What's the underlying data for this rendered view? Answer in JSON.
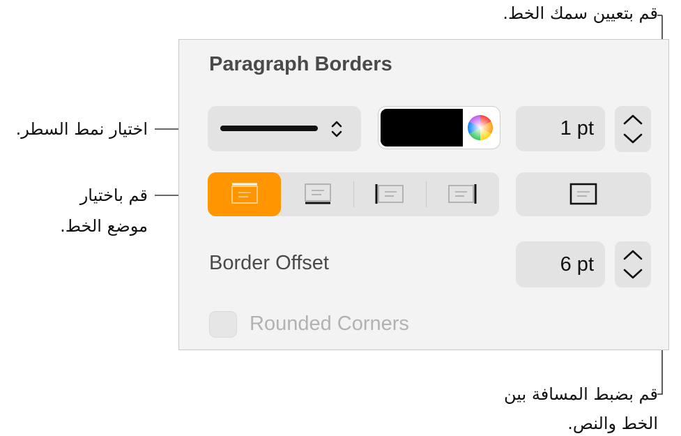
{
  "callouts": {
    "thickness": "قم بتعيين سمك الخط.",
    "line_style": "اختيار نمط السطر.",
    "position_line1": "قم باختيار",
    "position_line2": "موضع الخط.",
    "offset_line1": "قم بضبط المسافة بين",
    "offset_line2": "الخط والنص."
  },
  "panel": {
    "title": "Paragraph Borders",
    "line_style": "solid",
    "border_color": "#000000",
    "thickness_value": "1 pt",
    "position_buttons": [
      "top",
      "bottom",
      "left",
      "right"
    ],
    "selected_position": "top",
    "box_button": "box",
    "border_offset_label": "Border Offset",
    "border_offset_value": "6 pt",
    "rounded_corners_label": "Rounded Corners",
    "rounded_corners_checked": false
  },
  "colors": {
    "accent": "#ff9500",
    "control_bg": "#e3e3e3",
    "panel_bg": "#f3f3f3"
  }
}
